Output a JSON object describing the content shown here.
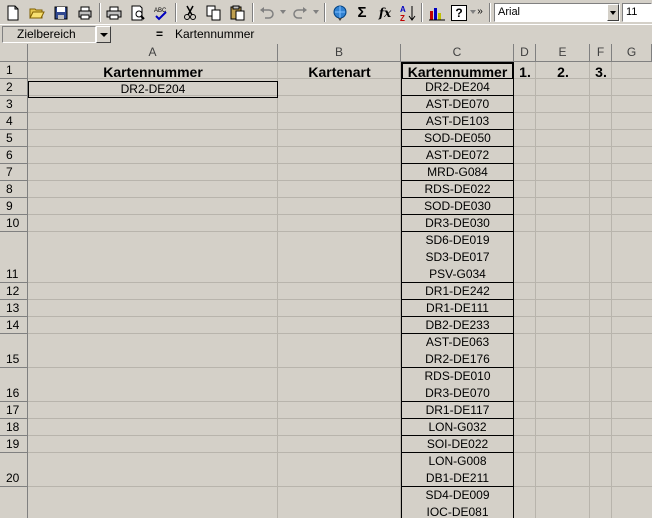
{
  "toolbar": {
    "icons": [
      "new-file-icon",
      "open-folder-icon",
      "save-icon",
      "print-preview-icon",
      "print-icon",
      "preview-icon",
      "spellcheck-icon",
      "cut-icon",
      "copy-icon",
      "paste-icon",
      "undo-icon",
      "redo-icon",
      "hyperlink-icon",
      "autosum-icon",
      "function-icon",
      "sort-ascending-icon",
      "chart-icon",
      "help-icon"
    ],
    "sum_glyph": "Σ",
    "fx_glyph": "fx",
    "help_glyph": "?",
    "font_name": "Arial",
    "font_size": "11"
  },
  "formula_bar": {
    "name_box": "Zielbereich",
    "equals": "=",
    "content": "Kartennummer"
  },
  "columns": [
    {
      "letter": "A"
    },
    {
      "letter": "B"
    },
    {
      "letter": "C"
    },
    {
      "letter": "D"
    },
    {
      "letter": "E"
    },
    {
      "letter": "F"
    },
    {
      "letter": "G"
    }
  ],
  "header_row": {
    "a": "Kartennummer",
    "b": "Kartenart",
    "c": "Kartennummer",
    "d": "1.",
    "e": "2.",
    "f": "3."
  },
  "cell_a2": "DR2-DE204",
  "rows": [
    {
      "num": "1",
      "lines": 1
    },
    {
      "num": "2",
      "lines": 1,
      "c": [
        "DR2-DE204"
      ]
    },
    {
      "num": "3",
      "lines": 1,
      "c": [
        "AST-DE070"
      ]
    },
    {
      "num": "4",
      "lines": 1,
      "c": [
        "AST-DE103"
      ]
    },
    {
      "num": "5",
      "lines": 1,
      "c": [
        "SOD-DE050"
      ]
    },
    {
      "num": "6",
      "lines": 1,
      "c": [
        "AST-DE072"
      ]
    },
    {
      "num": "7",
      "lines": 1,
      "c": [
        "MRD-G084"
      ]
    },
    {
      "num": "8",
      "lines": 1,
      "c": [
        "RDS-DE022"
      ]
    },
    {
      "num": "9",
      "lines": 1,
      "c": [
        "SOD-DE030"
      ]
    },
    {
      "num": "10",
      "lines": 1,
      "c": [
        "DR3-DE030"
      ]
    },
    {
      "num": "11",
      "lines": 3,
      "c": [
        "SD6-DE019",
        "SD3-DE017",
        "PSV-G034"
      ]
    },
    {
      "num": "12",
      "lines": 1,
      "c": [
        "DR1-DE242"
      ]
    },
    {
      "num": "13",
      "lines": 1,
      "c": [
        "DR1-DE111"
      ]
    },
    {
      "num": "14",
      "lines": 1,
      "c": [
        "DB2-DE233"
      ]
    },
    {
      "num": "15",
      "lines": 2,
      "c": [
        "AST-DE063",
        "DR2-DE176"
      ]
    },
    {
      "num": "16",
      "lines": 2,
      "c": [
        "RDS-DE010",
        "DR3-DE070"
      ]
    },
    {
      "num": "17",
      "lines": 1,
      "c": [
        "DR1-DE117"
      ]
    },
    {
      "num": "18",
      "lines": 1,
      "c": [
        "LON-G032"
      ]
    },
    {
      "num": "19",
      "lines": 1,
      "c": [
        "SOI-DE022"
      ]
    },
    {
      "num": "20",
      "lines": 2,
      "c": [
        "LON-G008",
        "DB1-DE211"
      ]
    },
    {
      "num": "",
      "lines": 2,
      "c": [
        "SD4-DE009",
        "IOC-DE081"
      ]
    }
  ]
}
